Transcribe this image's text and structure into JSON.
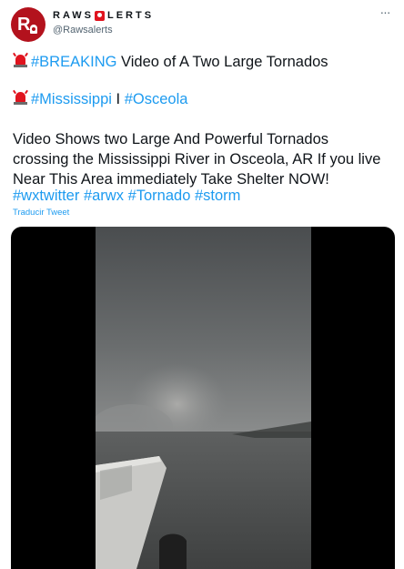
{
  "account": {
    "display_name_part1": "RAWS",
    "display_name_part2": "LERTS",
    "handle": "@Rawsalerts",
    "avatar_icon": "rawsalerts-logo-icon"
  },
  "tweet": {
    "line1": {
      "hashtag": "#BREAKING",
      "text": " Video of A Two Large Tornados"
    },
    "line2": {
      "hashtag1": "#Mississippi",
      "sep": " I ",
      "hashtag2": "#Osceola"
    },
    "body_lines": [
      "Video Shows two Large And Powerful Tornados",
      "crossing the Mississippi River in Osceola, AR If you live",
      "Near This Area immediately Take Shelter NOW!"
    ],
    "hashtags": [
      "#wxtwitter",
      "#arwx",
      "#Tornado",
      "#storm"
    ],
    "translate_label": "Traducir Tweet"
  },
  "colors": {
    "link": "#1d9bf0",
    "siren_red": "#e0141e",
    "avatar_red": "#b3121d"
  }
}
